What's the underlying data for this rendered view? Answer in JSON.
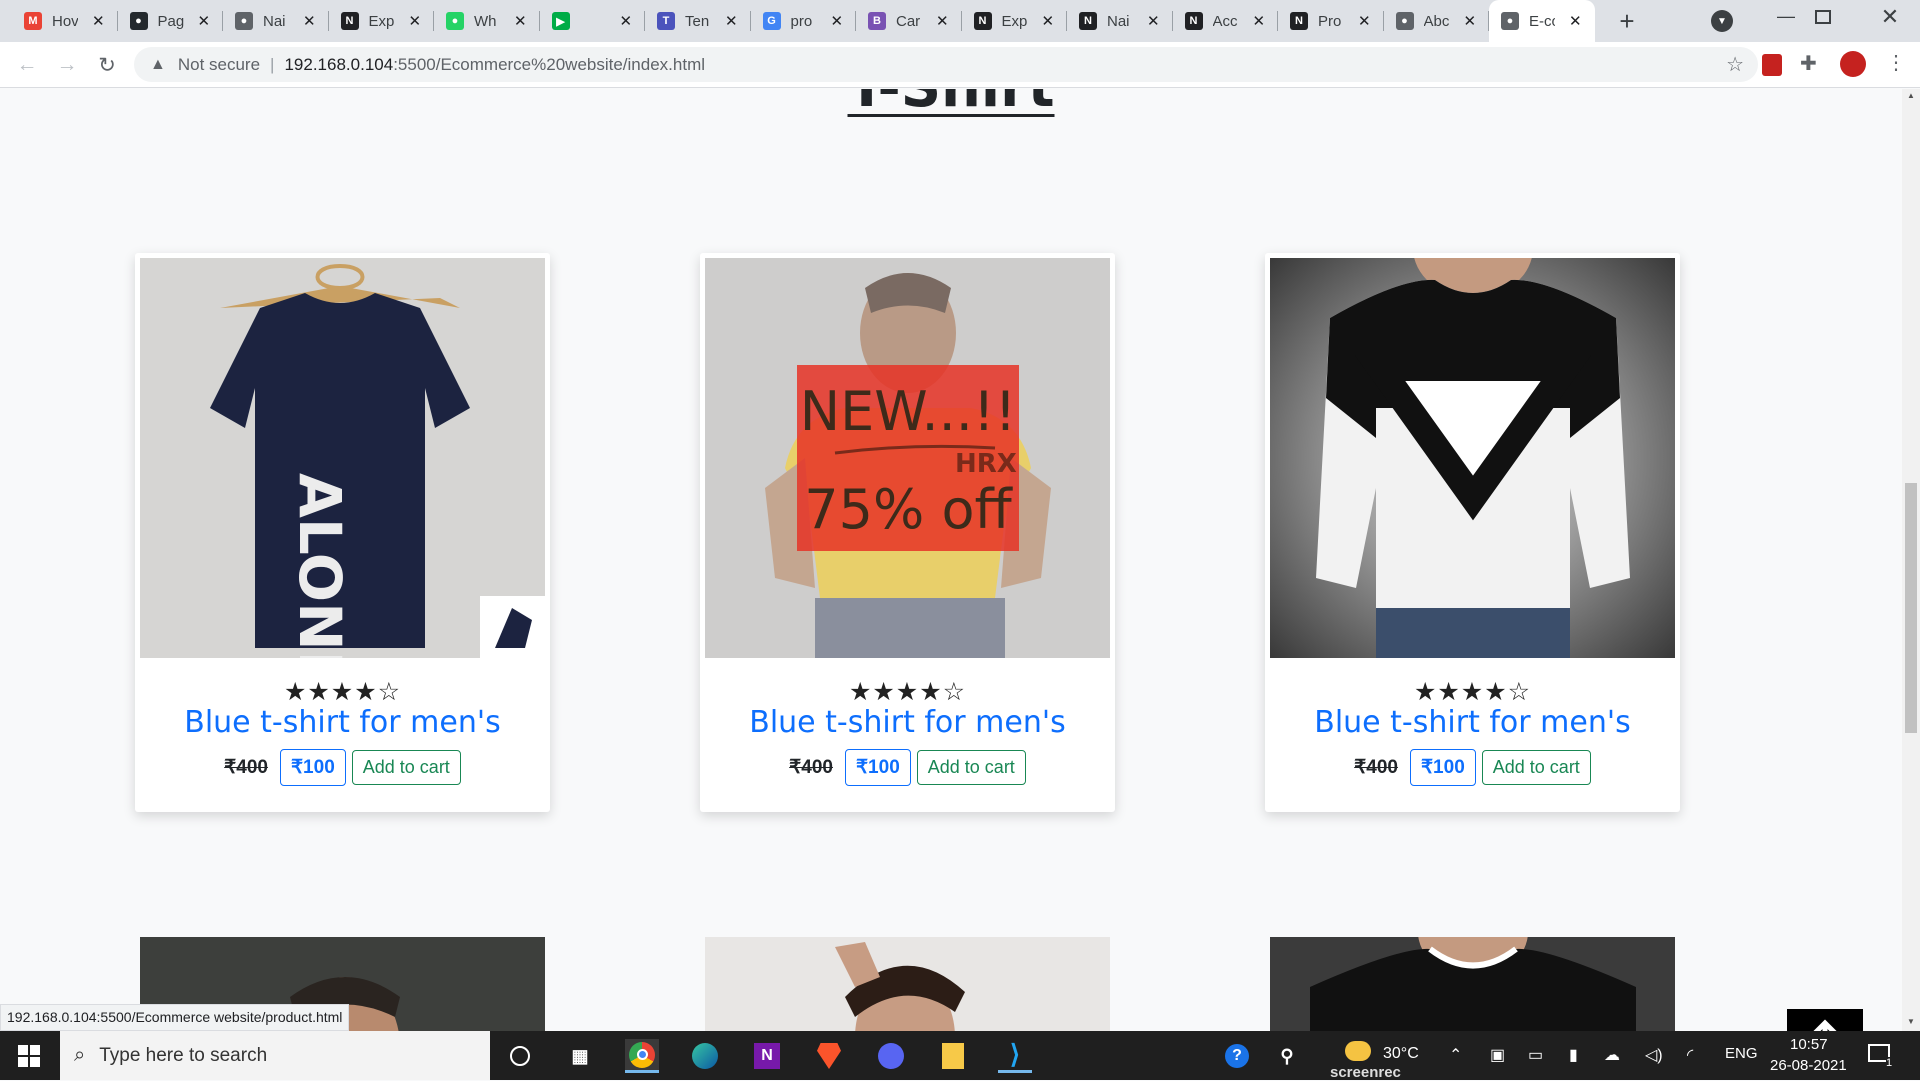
{
  "browser": {
    "tabs": [
      {
        "label": "Hov",
        "icon": "gmail-icon",
        "color": "#ea4335",
        "glyph": "M"
      },
      {
        "label": "Pag",
        "icon": "github-icon",
        "color": "#24292e",
        "glyph": "●"
      },
      {
        "label": "Nai",
        "icon": "globe-icon",
        "color": "#5f6368",
        "glyph": "●"
      },
      {
        "label": "Exp",
        "icon": "nptel-icon",
        "color": "#202124",
        "glyph": "N"
      },
      {
        "label": "Wh",
        "icon": "whatsapp-icon",
        "color": "#25d366",
        "glyph": "●"
      },
      {
        "label": "",
        "icon": "meet-icon",
        "color": "#00ac47",
        "glyph": "▶"
      },
      {
        "label": "Ten",
        "icon": "teams-icon",
        "color": "#4b53bc",
        "glyph": "T"
      },
      {
        "label": "pro",
        "icon": "google-icon",
        "color": "#4285f4",
        "glyph": "G"
      },
      {
        "label": "Car",
        "icon": "bootstrap-icon",
        "color": "#7952b3",
        "glyph": "B"
      },
      {
        "label": "Exp",
        "icon": "nptel-icon",
        "color": "#202124",
        "glyph": "N"
      },
      {
        "label": "Nai",
        "icon": "nptel-icon",
        "color": "#202124",
        "glyph": "N"
      },
      {
        "label": "Acc",
        "icon": "nptel-icon",
        "color": "#202124",
        "glyph": "N"
      },
      {
        "label": "Pro",
        "icon": "nptel-icon",
        "color": "#202124",
        "glyph": "N"
      },
      {
        "label": "Abc",
        "icon": "globe-icon",
        "color": "#5f6368",
        "glyph": "●"
      },
      {
        "label": "E-co",
        "icon": "globe-icon",
        "color": "#5f6368",
        "glyph": "●",
        "active": true
      }
    ],
    "security_label": "Not secure",
    "url_host": "192.168.0.104",
    "url_rest": ":5500/Ecommerce%20website/index.html"
  },
  "page": {
    "section_heading": "T-Shirt",
    "products": [
      {
        "stars": "★★★★☆",
        "title": "Blue t-shirt for men's",
        "old_price": "₹400",
        "price": "₹100",
        "cart_label": "Add to cart",
        "image": "navy-alone-tshirt"
      },
      {
        "stars": "★★★★☆",
        "title": "Blue t-shirt for men's",
        "old_price": "₹400",
        "price": "₹100",
        "cart_label": "Add to cart",
        "image": "yellow-hrx-tshirt",
        "badge_new": "NEW...!!",
        "badge_off": "75% off",
        "badge_brand": "HRX"
      },
      {
        "stars": "★★★★☆",
        "title": "Blue t-shirt for men's",
        "old_price": "₹400",
        "price": "₹100",
        "cart_label": "Add to cart",
        "image": "black-white-v-tshirt"
      }
    ],
    "status_url": "192.168.0.104:5500/Ecommerce website/product.html"
  },
  "taskbar": {
    "search_placeholder": "Type here to search",
    "weather": "30°C",
    "language": "ENG",
    "time": "10:57",
    "date": "26-08-2021",
    "notification_count": "1",
    "recorder_label": "screenrec"
  },
  "colors": {
    "accent": "#0d6efd",
    "success": "#198754",
    "badge_bg": "#e63226"
  }
}
